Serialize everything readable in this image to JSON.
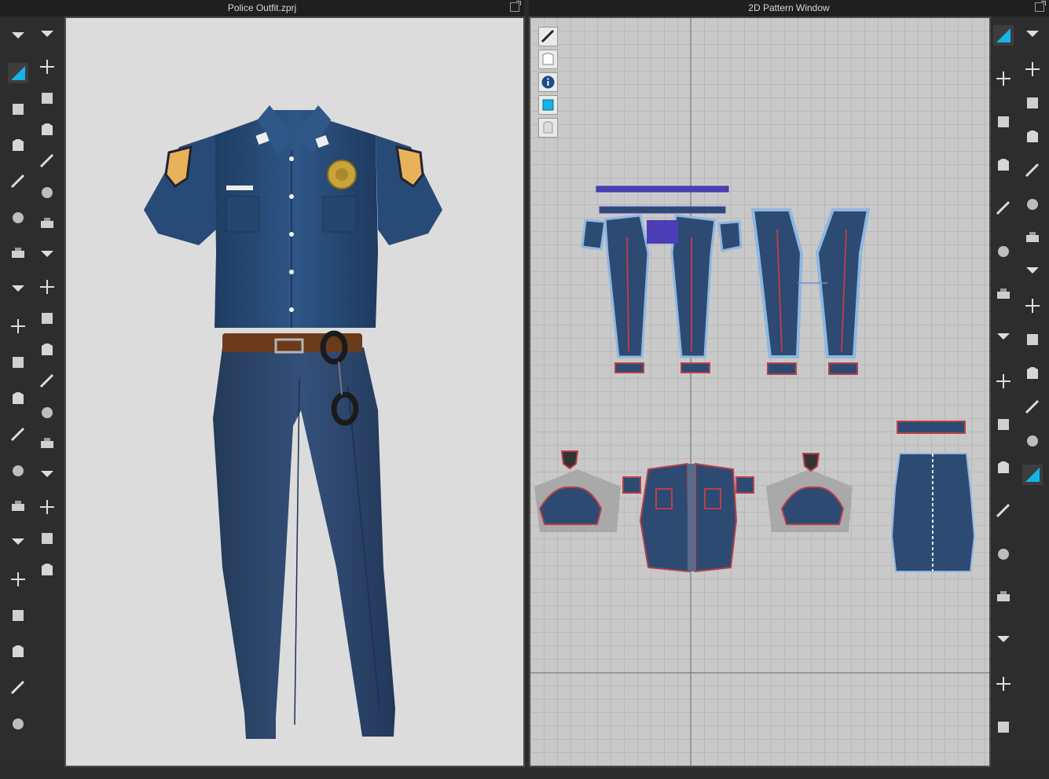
{
  "window": {
    "left_title": "Police Outfit.zprj",
    "right_title": "2D Pattern Window"
  },
  "colors": {
    "uniform_blue": "#2b4f7c",
    "pants_blue": "#2d4a6e",
    "belt_brown": "#6b3b1c",
    "badge_gold": "#c9a43a",
    "pattern_outline": "#4b3fb8",
    "pattern_fill": "#2c4a72",
    "seam_red": "#b8404a",
    "active_tool": "#12b5e6"
  },
  "left_toolbar": {
    "col1_icons": [
      "drop-arrow-icon",
      "transform-cross-icon",
      "edit-pen-icon",
      "garment-select-icon",
      "pin-box-icon",
      "fold-icon",
      "tack-icon",
      "flatten-icon",
      "line-tool-icon",
      "paint-icon",
      "puckering-icon",
      "zipper-icon",
      "shirt-icon",
      "rotate-shirt-icon",
      "avatar-icon",
      "measure-icon",
      "sharpen-icon",
      "pencil-icon",
      "shirt-down-icon",
      "shirt-stack-icon"
    ],
    "col2_icons": [
      "run-avatar-icon",
      "pin-icon",
      "fold-arrow-icon",
      "strip-icon",
      "fold-b-icon",
      "fold-c-icon",
      "button-icon",
      "texture-icon",
      "puzzle-icon",
      "check-icon",
      "button-circle-icon",
      "lock-icon",
      "zipper-b-icon",
      "gradient-icon",
      "toggle-icon",
      "grey-box-icon",
      "grey-box-b-icon",
      "adjust-icon"
    ]
  },
  "right_toolbar": {
    "col1_icons": [
      "transform-pattern-icon",
      "edit-points-icon",
      "polygon-icon",
      "rectangle-icon",
      "folder-icon",
      "internal-rect-icon",
      "cut-icon",
      "trace-icon",
      "fold-line-icon",
      "door-icon",
      "ruler-icon",
      "measure-b-icon",
      "text-small-icon",
      "text-large-icon",
      "grid-icon",
      "sewing-icon",
      "avatar-b-icon"
    ],
    "col2_icons": [
      "segment-icon",
      "free-sewing-icon",
      "line-sewing-icon",
      "tack-sewing-icon",
      "iron-icon",
      "shirt-sewing-icon",
      "check-sewing-icon",
      "layer-icon",
      "dashed-line-icon",
      "dotted-line-icon",
      "zig-icon",
      "elastic-icon",
      "fold-sewing-icon",
      "gift-box-icon"
    ]
  },
  "pattern_side_buttons": [
    "view-pen-icon",
    "view-shirt-icon",
    "info-icon",
    "texture-view-icon",
    "lock-shirt-icon"
  ]
}
